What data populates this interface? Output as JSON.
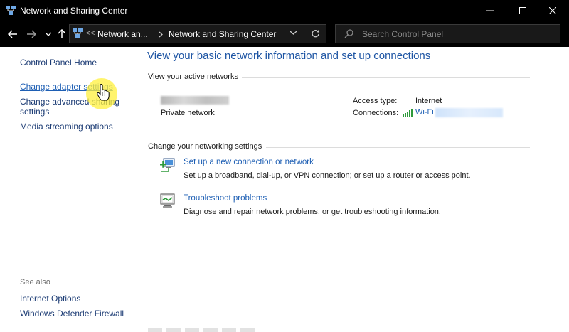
{
  "window": {
    "title": "Network and Sharing Center",
    "icon": "network-icon"
  },
  "address": {
    "overflow": "<<",
    "crumbs": [
      "Network an...",
      "Network and Sharing Center"
    ],
    "search_placeholder": "Search Control Panel"
  },
  "sidebar": {
    "items": [
      {
        "label": "Control Panel Home"
      },
      {
        "label": "Change adapter settings"
      },
      {
        "label": "Change advanced sharing\nsettings",
        "line1": "Change advanced sharing",
        "line2": "settings"
      },
      {
        "label": "Media streaming options"
      }
    ],
    "see_also": {
      "heading": "See also",
      "items": [
        {
          "label": "Internet Options"
        },
        {
          "label": "Windows Defender Firewall"
        }
      ]
    }
  },
  "main": {
    "title": "View your basic network information and set up connections",
    "active_networks": {
      "heading": "View your active networks",
      "network_type": "Private network",
      "access_type_label": "Access type:",
      "access_type_value": "Internet",
      "connections_label": "Connections:",
      "connection_name": "Wi-Fi"
    },
    "change_settings": {
      "heading": "Change your networking settings",
      "tasks": [
        {
          "link": "Set up a new connection or network",
          "desc": "Set up a broadband, dial-up, or VPN connection; or set up a router or access point."
        },
        {
          "link": "Troubleshoot problems",
          "desc": "Diagnose and repair network problems, or get troubleshooting information."
        }
      ]
    }
  },
  "colors": {
    "titlebar": "#000000",
    "link": "#1e5fb4",
    "heading": "#1e55a4",
    "highlight": "#fff03c"
  }
}
